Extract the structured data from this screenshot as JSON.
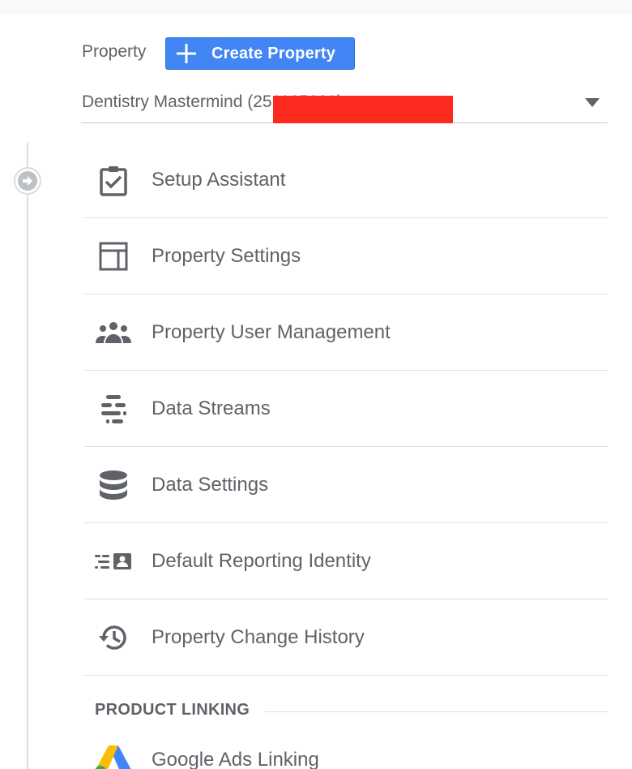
{
  "property": {
    "label": "Property",
    "create_button_label": "Create Property",
    "selected_value": "Dentistry Mastermind (251165631)"
  },
  "menu": {
    "items": [
      {
        "label": "Setup Assistant",
        "icon": "clipboard-check-icon"
      },
      {
        "label": "Property Settings",
        "icon": "layout-icon"
      },
      {
        "label": "Property User Management",
        "icon": "people-icon"
      },
      {
        "label": "Data Streams",
        "icon": "streams-icon"
      },
      {
        "label": "Data Settings",
        "icon": "database-icon"
      },
      {
        "label": "Default Reporting Identity",
        "icon": "reporting-identity-icon"
      },
      {
        "label": "Property Change History",
        "icon": "history-icon"
      }
    ]
  },
  "product_linking": {
    "header": "PRODUCT LINKING",
    "items": [
      {
        "label": "Google Ads Linking",
        "icon": "google-ads-icon"
      }
    ]
  },
  "colors": {
    "accent": "#4285f4",
    "text": "#5f6368",
    "redaction": "#ff2a1f"
  }
}
